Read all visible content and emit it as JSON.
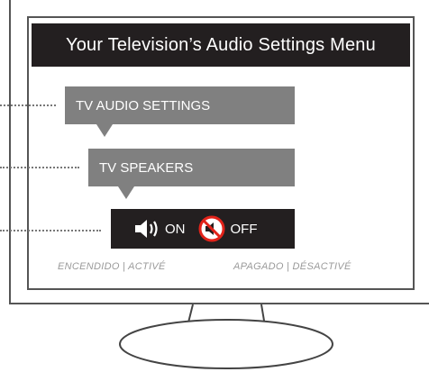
{
  "header": {
    "title": "Your Television’s Audio Settings Menu"
  },
  "menu": {
    "level1": "TV AUDIO SETTINGS",
    "level2": "TV SPEAKERS"
  },
  "options": {
    "on_label": "ON",
    "off_label": "OFF",
    "on_caption": "ENCENDIDO | ACTIVÉ",
    "off_caption": "APAGADO | DÉSACTIVÉ"
  },
  "colors": {
    "dark": "#231f20",
    "callout": "#808080",
    "mute_red": "#e2231a"
  },
  "icons": [
    "speaker-on-icon",
    "speaker-muted-icon"
  ]
}
